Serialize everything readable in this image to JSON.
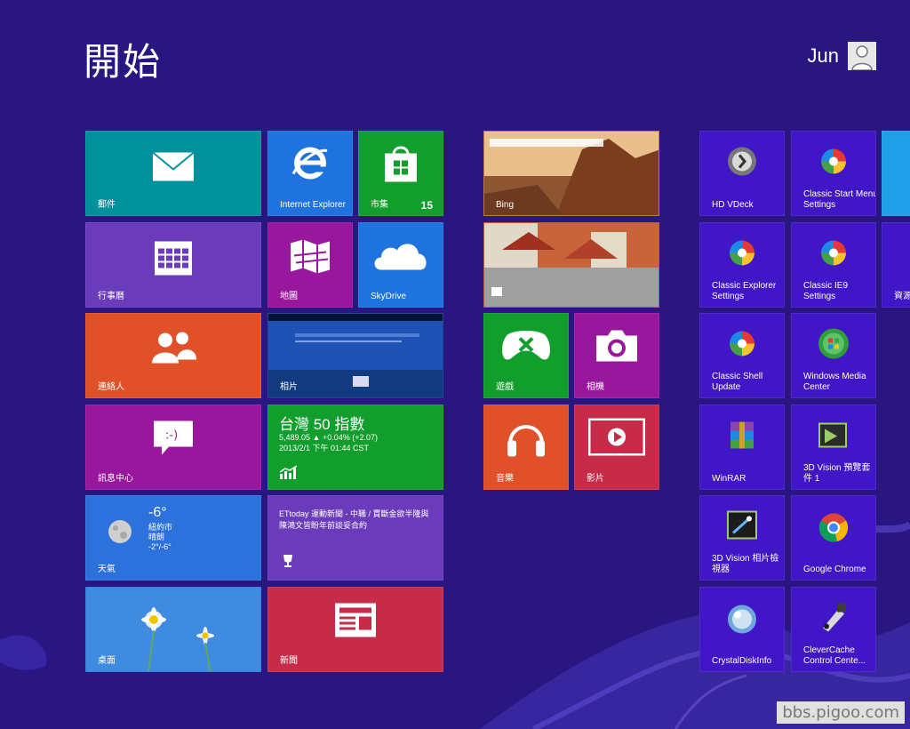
{
  "header": {
    "title": "開始",
    "user_name": "Jun"
  },
  "tiles": {
    "mail": "郵件",
    "ie": "Internet Explorer",
    "store": "市集",
    "store_badge": "15",
    "calendar": "行事曆",
    "maps": "地圖",
    "skydrive": "SkyDrive",
    "people": "連絡人",
    "photos": "相片",
    "messaging": "訊息中心",
    "finance": {
      "title": "台灣 50 指數",
      "line1": "5,489.05 ▲ +0.04% (+2.07)",
      "line2": "2013/2/1 下午 01:44 CST"
    },
    "weather": {
      "temp": "-6°",
      "city": "紐約市",
      "condition": "晴朗",
      "range": "-2°/-6°",
      "label": "天氣"
    },
    "sports": {
      "headline": "ETtoday 運動新聞 - 中職 / 賈斷金欲半隆與陳鴻文皆盼年前談妥合約"
    },
    "desktop": "桌面",
    "news": "新聞",
    "bing": "Bing",
    "games": "遊戲",
    "camera": "相機",
    "music": "音樂",
    "video": "影片",
    "hd_vdeck": "HD VDeck",
    "classic_start": "Classic Start Menu Settings",
    "classic_explorer": "Classic Explorer Settings",
    "classic_ie9": "Classic IE9 Settings",
    "resource": "資源",
    "classic_shell_update": "Classic Shell Update",
    "wmc": "Windows Media Center",
    "winrar": "WinRAR",
    "vision_preview": "3D Vision 預覽套件 1",
    "vision_viewer": "3D Vision 相片檢視器",
    "chrome": "Google Chrome",
    "crystal": "CrystalDiskInfo",
    "clevercache": "CleverCache Control Cente..."
  },
  "watermark": "bbs.pigoo.com",
  "colors": {
    "background": "#2a1680",
    "teal": "#00929c",
    "blue": "#1f73df",
    "green": "#119e2c",
    "purple": "#6a3bbb",
    "magenta": "#98179c",
    "orange": "#e0512a",
    "red": "#c62c49",
    "desktop_tile_blue": "#2c71dc",
    "app_tile": "#4016c6"
  }
}
